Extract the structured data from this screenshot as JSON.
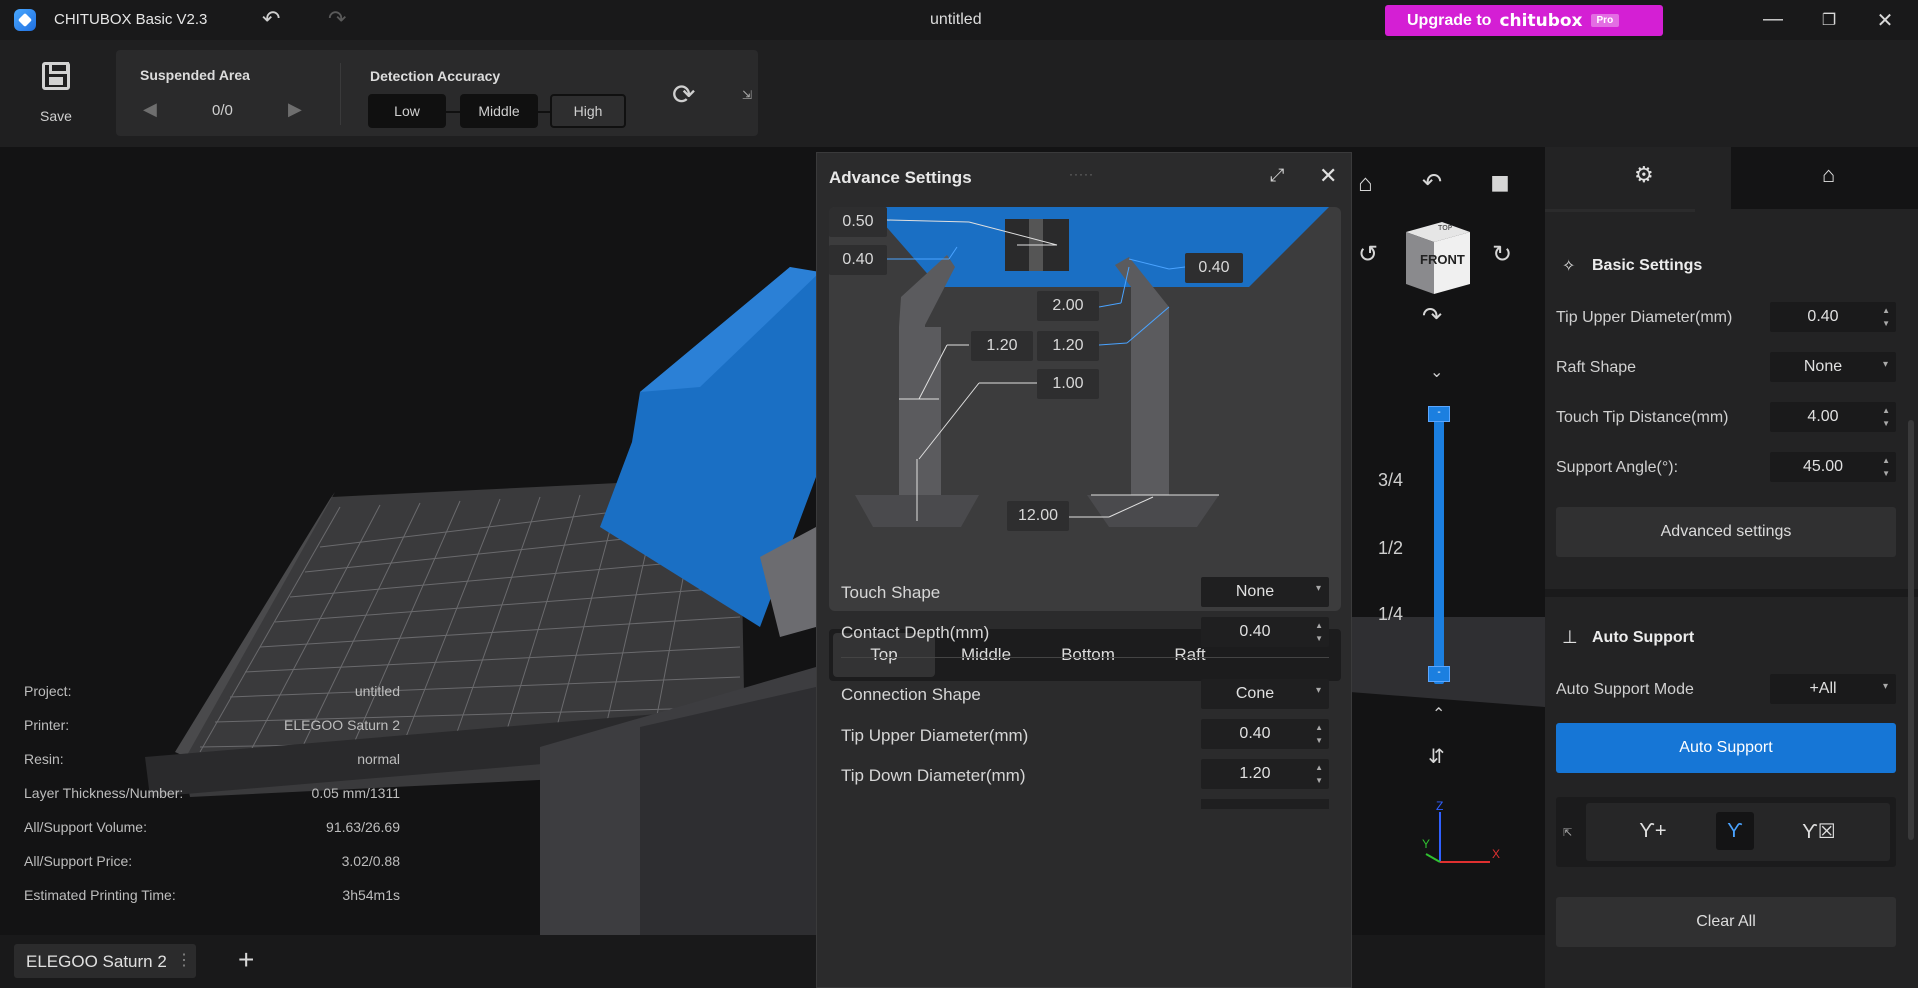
{
  "app": {
    "title": "CHITUBOX Basic V2.3",
    "document": "untitled"
  },
  "upgrade": {
    "label": "Upgrade to",
    "brand": "chitubox",
    "badge": "Pro"
  },
  "toolbar": {
    "save_label": "Save",
    "suspended_area": {
      "label": "Suspended Area",
      "value": "0/0"
    },
    "detection_accuracy": {
      "label": "Detection Accuracy",
      "options": [
        "Low",
        "Middle",
        "High"
      ],
      "selected": "High"
    }
  },
  "project_info": [
    {
      "key": "Project:",
      "value": "untitled"
    },
    {
      "key": "Printer:",
      "value": "ELEGOO Saturn 2"
    },
    {
      "key": "Resin:",
      "value": "normal"
    },
    {
      "key": "Layer Thickness/Number:",
      "value": "0.05 mm/1311"
    },
    {
      "key": "All/Support Volume:",
      "value": "91.63/26.69"
    },
    {
      "key": "All/Support Price:",
      "value": "3.02/0.88"
    },
    {
      "key": "Estimated Printing Time:",
      "value": "3h54m1s"
    }
  ],
  "bottom_tab": {
    "label": "ELEGOO Saturn 2"
  },
  "advance_settings": {
    "title": "Advance Settings",
    "diagram_labels": [
      "0.50",
      "0.40",
      "0.40",
      "2.00",
      "1.20",
      "1.20",
      "1.00",
      "12.00"
    ],
    "tabs": [
      "Top",
      "Middle",
      "Bottom",
      "Raft"
    ],
    "active_tab": "Top",
    "rows": [
      {
        "label": "Touch Shape",
        "value": "None",
        "type": "select"
      },
      {
        "label": "Contact Depth(mm)",
        "value": "0.40",
        "type": "spin"
      },
      {
        "label": "Connection Shape",
        "value": "Cone",
        "type": "select"
      },
      {
        "label": "Tip Upper Diameter(mm)",
        "value": "0.40",
        "type": "spin"
      },
      {
        "label": "Tip Down Diameter(mm)",
        "value": "1.20",
        "type": "spin"
      }
    ]
  },
  "view": {
    "cube_label": "FRONT",
    "cube_top": "TOP",
    "fractions": [
      "3/4",
      "1/2",
      "1/4"
    ],
    "axes": {
      "x": "X",
      "y": "Y",
      "z": "Z"
    }
  },
  "right_panel": {
    "basic_settings": {
      "title": "Basic Settings",
      "rows": [
        {
          "label": "Tip Upper Diameter(mm)",
          "value": "0.40",
          "type": "spin"
        },
        {
          "label": "Raft Shape",
          "value": "None",
          "type": "select"
        },
        {
          "label": "Touch Tip Distance(mm)",
          "value": "4.00",
          "type": "spin"
        },
        {
          "label": "Support Angle(°):",
          "value": "45.00",
          "type": "spin"
        }
      ],
      "advanced_button": "Advanced settings"
    },
    "auto_support": {
      "title": "Auto Support",
      "mode_label": "Auto Support Mode",
      "mode_value": "+All",
      "button": "Auto Support",
      "clear_button": "Clear All"
    }
  },
  "colors": {
    "accent": "#1676d6",
    "upgrade": "#d41fd4",
    "model": "#1a6fc4"
  }
}
